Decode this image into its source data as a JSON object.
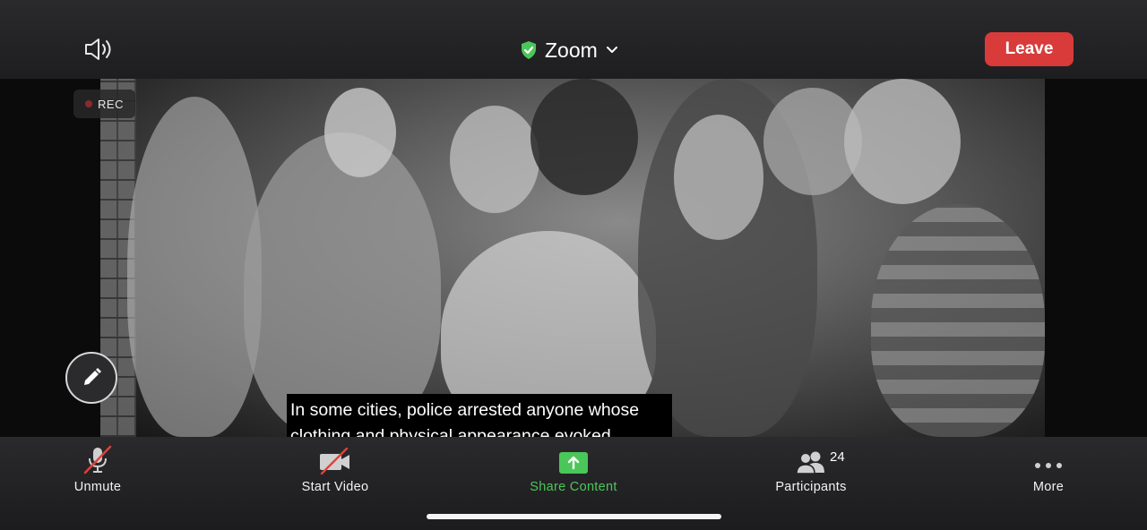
{
  "header": {
    "meeting_title": "Zoom",
    "leave_label": "Leave",
    "recording_label": "REC"
  },
  "video": {
    "caption_lines": [
      "In some cities, police arrested anyone whose",
      "clothing and physical appearance evoked"
    ]
  },
  "toolbar": {
    "unmute_label": "Unmute",
    "start_video_label": "Start Video",
    "share_label": "Share Content",
    "participants_label": "Participants",
    "participants_count": "24",
    "more_label": "More"
  },
  "colors": {
    "leave": "#d93a3a",
    "share": "#4bc659",
    "shield": "#4bc659",
    "muted_slash": "#e0413a"
  },
  "icons": {
    "speaker": "speaker-icon",
    "shield": "shield-check-icon",
    "chevron": "chevron-down-icon",
    "pencil": "pencil-icon",
    "mic": "mic-muted-icon",
    "camera": "camera-off-icon",
    "share": "share-up-arrow-icon",
    "participants": "people-icon",
    "more": "more-dots-icon"
  }
}
